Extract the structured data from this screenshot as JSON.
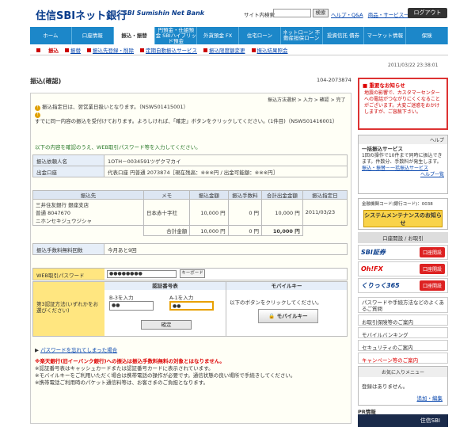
{
  "header": {
    "brand": "住信SBIネット銀行",
    "brand_en": "SBI Sumishin Net Bank",
    "search_label": "サイト内検索",
    "search_value": "",
    "search_btn": "検索",
    "help_link": "ヘルプ・Q&A",
    "products_link": "商品・サービス一覧",
    "logout": "ログアウト"
  },
  "nav": {
    "items": [
      "ホーム",
      "口座情報",
      "振込・振替",
      "円預金・仕組預金 SBIハイブリッド預金",
      "外貨預金 FX",
      "住宅ローン",
      "ネットローン 不動産担保ローン",
      "投資信託 債券",
      "マーケット情報",
      "保険"
    ]
  },
  "subnav": {
    "items": [
      "振込",
      "振替",
      "振込先登録・削除",
      "定期自動振込サービス",
      "振込限度額変更",
      "振込結果照会"
    ]
  },
  "datetime": "2011/03/22 23:38:01",
  "page": {
    "title": "振込(確認)",
    "number": "104-2073874",
    "steps": "振込方法選択 > 入力 > 確認 > 完了"
  },
  "warnings": [
    "振込指定日は、翌営業日扱いとなります。（NSW501415001）",
    "すでに同一内容の振込を受付けております。よろしければ、「確定」ボタンをクリックしてください。(1件目)（NSW501416001）"
  ],
  "confirm_text": "以下の内容を確認のうえ、WEB取引パスワード等を入力してください。",
  "recipient": {
    "label": "振込依頼人名",
    "value": "1OTH－0034591ツゲクマカイ"
  },
  "account": {
    "label": "出金口座",
    "value": "代表口座 円普通 2073874［現在残高：※※※円 / 出金可能額：※※※円］"
  },
  "transfer": {
    "headers": [
      "振込先",
      "メモ",
      "振込金額",
      "振込手数料",
      "合計出金金額",
      "振込指定日"
    ],
    "row": {
      "dest": "三井住友銀行 銀座支店\n普通 8047670\nニホンセキジュウジシャ",
      "memo": "日本赤十字社",
      "amount": "10,000 円",
      "fee": "0 円",
      "total": "10,000 円",
      "date": "2011/03/23"
    },
    "sum": {
      "label": "合計金額",
      "amount": "10,000 円",
      "fee": "0 円",
      "total": "10,000 円"
    }
  },
  "free": {
    "label": "振込手数料無料回数",
    "value": "今月あと9回"
  },
  "password": {
    "label": "WEB取引パスワード",
    "value": "●●●●●●●●",
    "keyboard": "キーボード"
  },
  "auth": {
    "label": "第3認証方法(いずれかをお選びください)",
    "card_title": "認証番号表",
    "b_label": "B-3を入力",
    "a_label": "A-1を入力",
    "b_value": "●●",
    "a_value": "●●",
    "confirm_btn": "確定",
    "mobile_title": "モバイルキー",
    "mobile_desc": "以下のボタンをクリックしてください。",
    "mobile_btn": "モバイルキー"
  },
  "forgot": "パスワードを忘れてしまった場合",
  "notes": {
    "red": "※楽天銀行(旧イーバンク銀行)への振込は振込手数料無料の対象とはなりません。",
    "n1": "※認証番号表はキャッシュカードまたは認証番号カードに表示されています。",
    "n2": "※モバイルキーをご利用いただく場合は携帯電話の操作が必要です。通信状態の良い場所で手続きしてください。",
    "n3": "※携帯電話ご利用時のパケット通信料等は、お客さまのご負担となります。"
  },
  "sidebar": {
    "news_title": "重要なお知らせ",
    "news_body": "地震の影響で、カスタマーセンターへの電話がつながりにくくなることがございます。大変ご迷惑をおかけしますが、ご容赦下さい。",
    "help_tab": "ヘルプ",
    "help_title": "一括振込サービス",
    "help_body": "1回の操作で10件まで同時に振込できます。件数分、手数料が発生します。",
    "help_link": "振込・振替－一括振込サービス",
    "help_more": "ヘルプ一覧",
    "maint_code": "金融機関コード(銀行コード)：0038",
    "maint_btn": "システムメンテナンスのお知らせ",
    "kz_title": "口座開設 / お取引",
    "kz_items": [
      {
        "logo": "SBI証券",
        "btn": "口座開設"
      },
      {
        "logo": "Oh!FX",
        "btn": "口座開設"
      },
      {
        "logo": "くりっく365",
        "btn": "口座開設"
      }
    ],
    "pwd_link": "パスワードや手続方法などのよくあるご質問",
    "links": [
      "お取引保険等のご案内",
      "モバイルバンキング",
      "セキュリティのご案内",
      "キャンペーン等のご案内"
    ],
    "fav_title": "お気に入りメニュー",
    "fav_body": "登録はありません。",
    "fav_add": "追加・編集",
    "pr_title": "PR情報",
    "pr_banner": "住信SBI"
  }
}
